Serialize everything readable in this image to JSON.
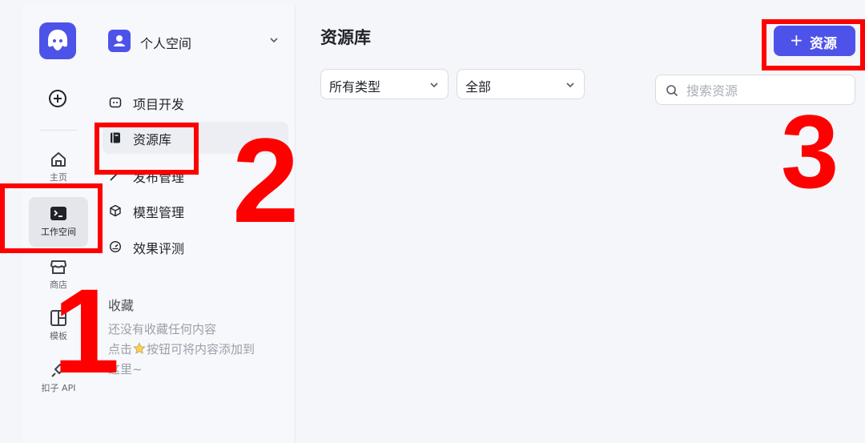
{
  "rail": {
    "items": [
      {
        "label": "主页",
        "icon": "home-icon"
      },
      {
        "label": "工作空间",
        "icon": "terminal-icon",
        "active": true
      },
      {
        "label": "商店",
        "icon": "store-icon"
      },
      {
        "label": "模板",
        "icon": "template-icon"
      },
      {
        "label": "扣子 API",
        "icon": "api-icon"
      }
    ]
  },
  "workspace": {
    "label": "个人空间"
  },
  "nav": {
    "items": [
      {
        "label": "项目开发",
        "icon": "project-icon"
      },
      {
        "label": "资源库",
        "icon": "book-icon",
        "active": true
      },
      {
        "label": "发布管理",
        "icon": "rocket-icon"
      },
      {
        "label": "模型管理",
        "icon": "cube-icon"
      },
      {
        "label": "效果评测",
        "icon": "gauge-icon"
      }
    ],
    "favorites_title": "收藏",
    "favorites_empty_1": "还没有收藏任何内容",
    "favorites_empty_2a": "点击",
    "favorites_empty_2b": "按钮可将内容添加到",
    "favorites_empty_3": "这里~"
  },
  "main": {
    "title": "资源库",
    "type_select": "所有类型",
    "scope_select": "全部",
    "search_placeholder": "搜索资源",
    "add_button_label": "资源"
  },
  "annotations": {
    "one": "1",
    "two": "2",
    "three": "3"
  },
  "colors": {
    "accent": "#4d53e8",
    "annotation": "#ff0000"
  }
}
